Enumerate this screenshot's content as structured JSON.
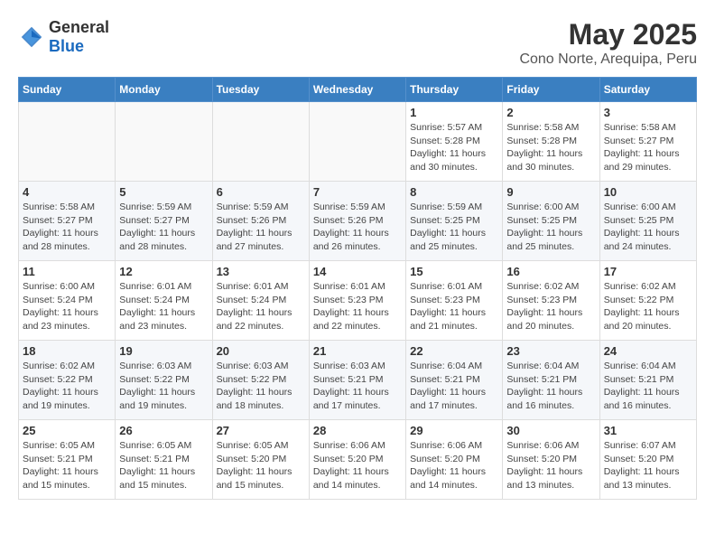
{
  "header": {
    "logo": {
      "general": "General",
      "blue": "Blue"
    },
    "title": "May 2025",
    "subtitle": "Cono Norte, Arequipa, Peru"
  },
  "days_of_week": [
    "Sunday",
    "Monday",
    "Tuesday",
    "Wednesday",
    "Thursday",
    "Friday",
    "Saturday"
  ],
  "weeks": [
    [
      {
        "num": "",
        "info": ""
      },
      {
        "num": "",
        "info": ""
      },
      {
        "num": "",
        "info": ""
      },
      {
        "num": "",
        "info": ""
      },
      {
        "num": "1",
        "info": "Sunrise: 5:57 AM\nSunset: 5:28 PM\nDaylight: 11 hours\nand 30 minutes."
      },
      {
        "num": "2",
        "info": "Sunrise: 5:58 AM\nSunset: 5:28 PM\nDaylight: 11 hours\nand 30 minutes."
      },
      {
        "num": "3",
        "info": "Sunrise: 5:58 AM\nSunset: 5:27 PM\nDaylight: 11 hours\nand 29 minutes."
      }
    ],
    [
      {
        "num": "4",
        "info": "Sunrise: 5:58 AM\nSunset: 5:27 PM\nDaylight: 11 hours\nand 28 minutes."
      },
      {
        "num": "5",
        "info": "Sunrise: 5:59 AM\nSunset: 5:27 PM\nDaylight: 11 hours\nand 28 minutes."
      },
      {
        "num": "6",
        "info": "Sunrise: 5:59 AM\nSunset: 5:26 PM\nDaylight: 11 hours\nand 27 minutes."
      },
      {
        "num": "7",
        "info": "Sunrise: 5:59 AM\nSunset: 5:26 PM\nDaylight: 11 hours\nand 26 minutes."
      },
      {
        "num": "8",
        "info": "Sunrise: 5:59 AM\nSunset: 5:25 PM\nDaylight: 11 hours\nand 25 minutes."
      },
      {
        "num": "9",
        "info": "Sunrise: 6:00 AM\nSunset: 5:25 PM\nDaylight: 11 hours\nand 25 minutes."
      },
      {
        "num": "10",
        "info": "Sunrise: 6:00 AM\nSunset: 5:25 PM\nDaylight: 11 hours\nand 24 minutes."
      }
    ],
    [
      {
        "num": "11",
        "info": "Sunrise: 6:00 AM\nSunset: 5:24 PM\nDaylight: 11 hours\nand 23 minutes."
      },
      {
        "num": "12",
        "info": "Sunrise: 6:01 AM\nSunset: 5:24 PM\nDaylight: 11 hours\nand 23 minutes."
      },
      {
        "num": "13",
        "info": "Sunrise: 6:01 AM\nSunset: 5:24 PM\nDaylight: 11 hours\nand 22 minutes."
      },
      {
        "num": "14",
        "info": "Sunrise: 6:01 AM\nSunset: 5:23 PM\nDaylight: 11 hours\nand 22 minutes."
      },
      {
        "num": "15",
        "info": "Sunrise: 6:01 AM\nSunset: 5:23 PM\nDaylight: 11 hours\nand 21 minutes."
      },
      {
        "num": "16",
        "info": "Sunrise: 6:02 AM\nSunset: 5:23 PM\nDaylight: 11 hours\nand 20 minutes."
      },
      {
        "num": "17",
        "info": "Sunrise: 6:02 AM\nSunset: 5:22 PM\nDaylight: 11 hours\nand 20 minutes."
      }
    ],
    [
      {
        "num": "18",
        "info": "Sunrise: 6:02 AM\nSunset: 5:22 PM\nDaylight: 11 hours\nand 19 minutes."
      },
      {
        "num": "19",
        "info": "Sunrise: 6:03 AM\nSunset: 5:22 PM\nDaylight: 11 hours\nand 19 minutes."
      },
      {
        "num": "20",
        "info": "Sunrise: 6:03 AM\nSunset: 5:22 PM\nDaylight: 11 hours\nand 18 minutes."
      },
      {
        "num": "21",
        "info": "Sunrise: 6:03 AM\nSunset: 5:21 PM\nDaylight: 11 hours\nand 17 minutes."
      },
      {
        "num": "22",
        "info": "Sunrise: 6:04 AM\nSunset: 5:21 PM\nDaylight: 11 hours\nand 17 minutes."
      },
      {
        "num": "23",
        "info": "Sunrise: 6:04 AM\nSunset: 5:21 PM\nDaylight: 11 hours\nand 16 minutes."
      },
      {
        "num": "24",
        "info": "Sunrise: 6:04 AM\nSunset: 5:21 PM\nDaylight: 11 hours\nand 16 minutes."
      }
    ],
    [
      {
        "num": "25",
        "info": "Sunrise: 6:05 AM\nSunset: 5:21 PM\nDaylight: 11 hours\nand 15 minutes."
      },
      {
        "num": "26",
        "info": "Sunrise: 6:05 AM\nSunset: 5:21 PM\nDaylight: 11 hours\nand 15 minutes."
      },
      {
        "num": "27",
        "info": "Sunrise: 6:05 AM\nSunset: 5:20 PM\nDaylight: 11 hours\nand 15 minutes."
      },
      {
        "num": "28",
        "info": "Sunrise: 6:06 AM\nSunset: 5:20 PM\nDaylight: 11 hours\nand 14 minutes."
      },
      {
        "num": "29",
        "info": "Sunrise: 6:06 AM\nSunset: 5:20 PM\nDaylight: 11 hours\nand 14 minutes."
      },
      {
        "num": "30",
        "info": "Sunrise: 6:06 AM\nSunset: 5:20 PM\nDaylight: 11 hours\nand 13 minutes."
      },
      {
        "num": "31",
        "info": "Sunrise: 6:07 AM\nSunset: 5:20 PM\nDaylight: 11 hours\nand 13 minutes."
      }
    ]
  ]
}
